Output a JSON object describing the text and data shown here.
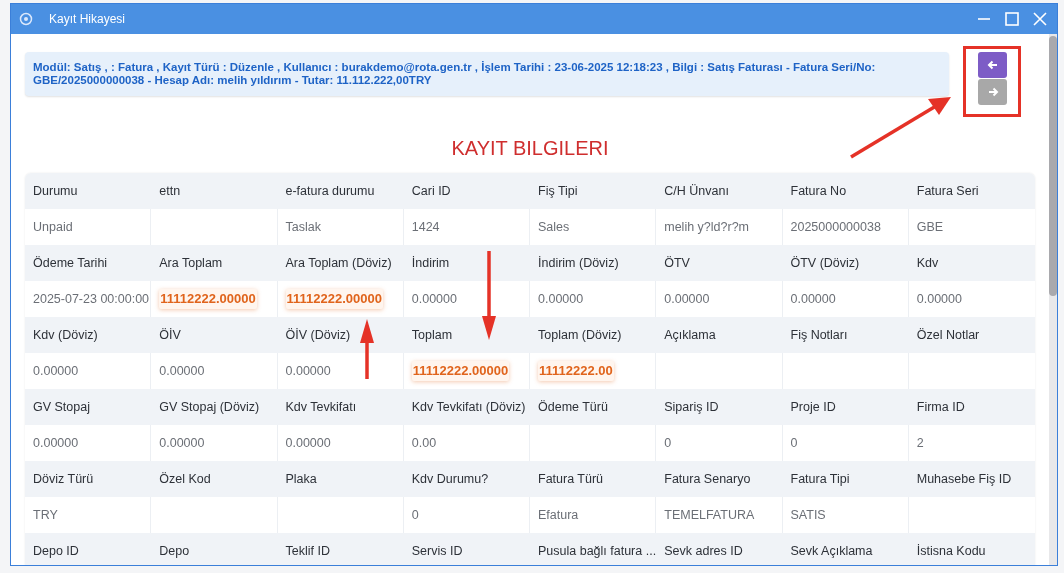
{
  "window": {
    "title": "Kayıt Hikayesi"
  },
  "info_banner": "Modül: Satış , : Fatura , Kayıt Türü : Düzenle , Kullanıcı : burakdemo@rota.gen.tr , İşlem Tarihi : 23-06-2025 12:18:23 , Bilgi : Satış Faturası - Fatura Seri/No: GBE/2025000000038 - Hesap Adı: melih yıldırım - Tutar: 11.112.222,00TRY",
  "nav_buttons": [
    {
      "kind": "previous",
      "disabled": false
    },
    {
      "kind": "next",
      "disabled": true
    }
  ],
  "heading": "KAYIT BILGILERI",
  "record_groups": [
    {
      "fields": [
        {
          "label": "Durumu",
          "value": "Unpaid",
          "highlight": false
        },
        {
          "label": "ettn"
        },
        {
          "label": "e-fatura durumu",
          "value": "Taslak",
          "highlight": false
        },
        {
          "label": "Cari ID",
          "value": "1424",
          "highlight": false
        },
        {
          "label": "Fiş Tipi",
          "value": "Sales",
          "highlight": false
        },
        {
          "label": "C/H Ünvanı",
          "value": "melih y?ld?r?m",
          "highlight": false
        },
        {
          "label": "Fatura No",
          "value": "2025000000038",
          "highlight": false
        },
        {
          "label": "Fatura Seri",
          "value": "GBE",
          "highlight": false
        }
      ]
    },
    {
      "fields": [
        {
          "label": "Ödeme Tarihi",
          "value": "2025-07-23 00:00:00",
          "highlight": false
        },
        {
          "label": "Ara Toplam",
          "value": "11112222.00000",
          "highlight": true
        },
        {
          "label": "Ara Toplam (Döviz)",
          "value": "11112222.00000",
          "highlight": true
        },
        {
          "label": "İndirim",
          "value": "0.00000",
          "highlight": false
        },
        {
          "label": "İndirim (Döviz)",
          "value": "0.00000",
          "highlight": false
        },
        {
          "label": "ÖTV",
          "value": "0.00000",
          "highlight": false
        },
        {
          "label": "ÖTV (Döviz)",
          "value": "0.00000",
          "highlight": false
        },
        {
          "label": "Kdv",
          "value": "0.00000",
          "highlight": false
        }
      ]
    },
    {
      "fields": [
        {
          "label": "Kdv (Döviz)",
          "value": "0.00000",
          "highlight": false
        },
        {
          "label": "ÖİV",
          "value": "0.00000",
          "highlight": false
        },
        {
          "label": "ÖİV (Döviz)",
          "value": "0.00000",
          "highlight": false
        },
        {
          "label": "Toplam",
          "value": "11112222.00000",
          "highlight": true
        },
        {
          "label": "Toplam (Döviz)",
          "value": "11112222.00",
          "highlight": true
        },
        {
          "label": "Açıklama"
        },
        {
          "label": "Fiş Notları"
        },
        {
          "label": "Özel Notlar"
        }
      ]
    },
    {
      "fields": [
        {
          "label": "GV Stopaj",
          "value": "0.00000",
          "highlight": false
        },
        {
          "label": "GV Stopaj (Döviz)",
          "value": "0.00000",
          "highlight": false
        },
        {
          "label": "Kdv Tevkifatı",
          "value": "0.00000",
          "highlight": false
        },
        {
          "label": "Kdv Tevkifatı (Döviz)",
          "value": "0.00",
          "highlight": false
        },
        {
          "label": "Ödeme Türü"
        },
        {
          "label": "Sipariş ID",
          "value": "0",
          "highlight": false
        },
        {
          "label": "Proje ID",
          "value": "0",
          "highlight": false
        },
        {
          "label": "Firma ID",
          "value": "2",
          "highlight": false
        }
      ]
    },
    {
      "fields": [
        {
          "label": "Döviz Türü",
          "value": "TRY",
          "highlight": false
        },
        {
          "label": "Özel Kod"
        },
        {
          "label": "Plaka"
        },
        {
          "label": "Kdv Durumu?",
          "value": "0",
          "highlight": false
        },
        {
          "label": "Fatura Türü",
          "value": "Efatura",
          "highlight": false
        },
        {
          "label": "Fatura Senaryo",
          "value": "TEMELFATURA",
          "highlight": false
        },
        {
          "label": "Fatura Tipi",
          "value": "SATIS",
          "highlight": false
        },
        {
          "label": "Muhasebe Fiş ID"
        }
      ]
    },
    {
      "fields": [
        {
          "label": "Depo ID"
        },
        {
          "label": "Depo"
        },
        {
          "label": "Teklif ID"
        },
        {
          "label": "Servis ID"
        },
        {
          "label": "Pusula bağlı fatura ..."
        },
        {
          "label": "Sevk adres ID"
        },
        {
          "label": "Sevk Açıklama"
        },
        {
          "label": "İstisna Kodu"
        }
      ]
    }
  ]
}
